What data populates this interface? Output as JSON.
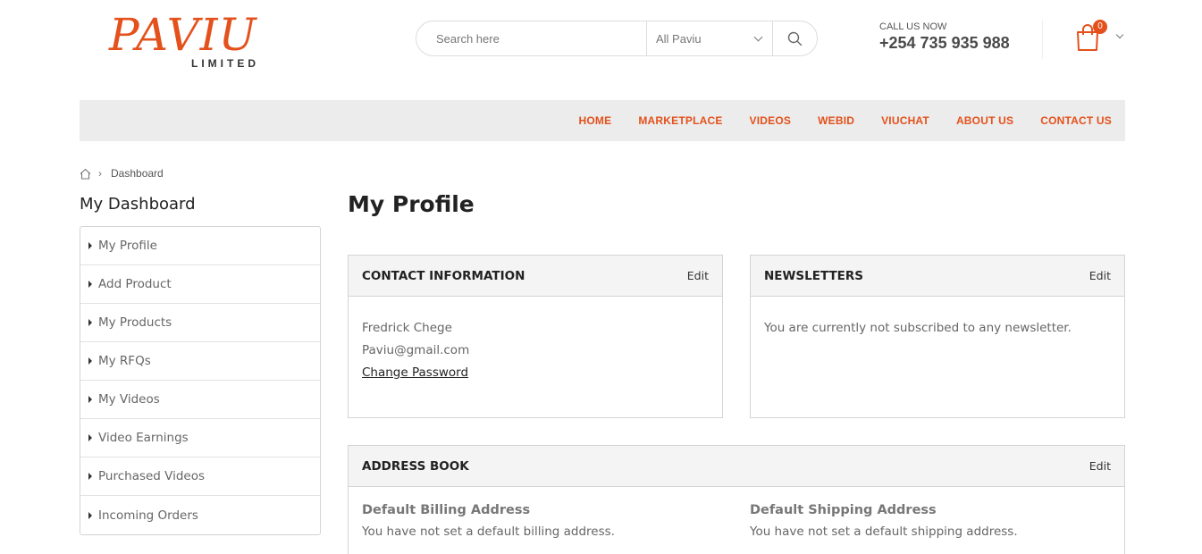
{
  "header": {
    "logo_main": "PAVIU",
    "logo_sub": "LIMITED",
    "search_placeholder": "Search here",
    "search_category": "All Paviu",
    "call_label": "CALL US NOW",
    "call_number": "+254 735 935 988",
    "cart_count": "0"
  },
  "nav": {
    "items": [
      "HOME",
      "MARKETPLACE",
      "VIDEOS",
      "WEBID",
      "VIUCHAT",
      "ABOUT US",
      "CONTACT US"
    ]
  },
  "breadcrumb": {
    "current": "Dashboard"
  },
  "sidebar": {
    "title": "My Dashboard",
    "items": [
      "My Profile",
      "Add Product",
      "My Products",
      "My RFQs",
      "My Videos",
      "Video Earnings",
      "Purchased Videos",
      "Incoming Orders"
    ]
  },
  "main": {
    "title": "My Profile",
    "contact": {
      "title": "CONTACT INFORMATION",
      "edit": "Edit",
      "name": "Fredrick Chege",
      "email": "Paviu@gmail.com",
      "change_password": "Change Password"
    },
    "newsletters": {
      "title": "NEWSLETTERS",
      "edit": "Edit",
      "text": "You are currently not subscribed to any newsletter."
    },
    "address_book": {
      "title": "ADDRESS BOOK",
      "edit": "Edit",
      "billing_title": "Default Billing Address",
      "billing_text": "You have not set a default billing address.",
      "shipping_title": "Default Shipping Address",
      "shipping_text": "You have not set a default shipping address."
    }
  },
  "colors": {
    "accent": "#e4511c",
    "nav_bg": "#ececec",
    "box_head_bg": "#f4f4f4"
  }
}
